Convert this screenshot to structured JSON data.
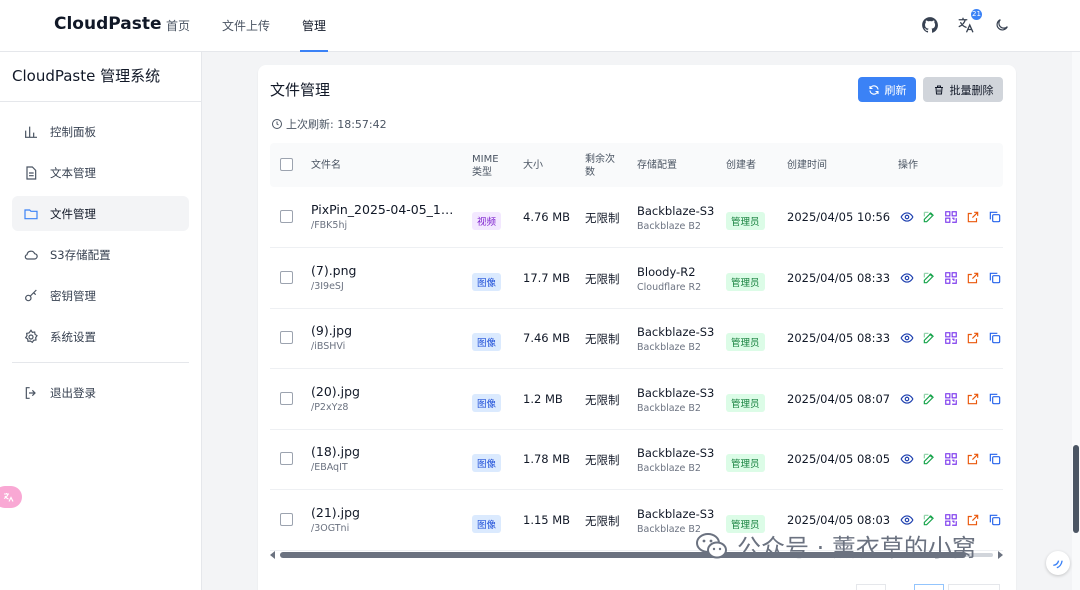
{
  "header": {
    "brand": "CloudPaste",
    "nav": [
      {
        "label": "首页",
        "active": false
      },
      {
        "label": "文件上传",
        "active": false
      },
      {
        "label": "管理",
        "active": true
      }
    ],
    "translate_badge": "21",
    "icons": [
      "github-icon",
      "translate-icon",
      "moon-icon"
    ]
  },
  "sidebar": {
    "title": "CloudPaste 管理系统",
    "items": [
      {
        "label": "控制面板",
        "icon": "chart-icon",
        "active": false
      },
      {
        "label": "文本管理",
        "icon": "document-icon",
        "active": false
      },
      {
        "label": "文件管理",
        "icon": "folder-icon",
        "active": true
      },
      {
        "label": "S3存储配置",
        "icon": "cloud-icon",
        "active": false
      },
      {
        "label": "密钥管理",
        "icon": "key-icon",
        "active": false
      },
      {
        "label": "系统设置",
        "icon": "gear-icon",
        "active": false
      }
    ],
    "logout": {
      "label": "退出登录",
      "icon": "logout-icon"
    }
  },
  "main": {
    "title": "文件管理",
    "refresh_label": "刷新",
    "batch_delete_label": "批量删除",
    "last_refresh": "上次刷新: 18:57:42",
    "columns": {
      "filename": "文件名",
      "mime_line1": "MIME",
      "mime_line2": "类型",
      "size": "大小",
      "remaining_line1": "剩余次",
      "remaining_line2": "数",
      "storage": "存储配置",
      "creator": "创建者",
      "created_at": "创建时间",
      "actions": "操作"
    },
    "rows": [
      {
        "name": "PixPin_2025-04-05_18...",
        "path": "/FBK5hj",
        "mime": "视频",
        "mime_kind": "video",
        "size": "4.76 MB",
        "remaining": "无限制",
        "storage": "Backblaze-S3",
        "storage_sub": "Backblaze B2",
        "creator": "管理员",
        "created": "2025/04/05 10:56"
      },
      {
        "name": "(7).png",
        "path": "/3I9eSJ",
        "mime": "图像",
        "mime_kind": "image",
        "size": "17.7 MB",
        "remaining": "无限制",
        "storage": "Bloody-R2",
        "storage_sub": "Cloudflare R2",
        "creator": "管理员",
        "created": "2025/04/05 08:33"
      },
      {
        "name": "(9).jpg",
        "path": "/iBSHVi",
        "mime": "图像",
        "mime_kind": "image",
        "size": "7.46 MB",
        "remaining": "无限制",
        "storage": "Backblaze-S3",
        "storage_sub": "Backblaze B2",
        "creator": "管理员",
        "created": "2025/04/05 08:33"
      },
      {
        "name": "(20).jpg",
        "path": "/P2xYz8",
        "mime": "图像",
        "mime_kind": "image",
        "size": "1.2 MB",
        "remaining": "无限制",
        "storage": "Backblaze-S3",
        "storage_sub": "Backblaze B2",
        "creator": "管理员",
        "created": "2025/04/05 08:07"
      },
      {
        "name": "(18).jpg",
        "path": "/EBAqIT",
        "mime": "图像",
        "mime_kind": "image",
        "size": "1.78 MB",
        "remaining": "无限制",
        "storage": "Backblaze-S3",
        "storage_sub": "Backblaze B2",
        "creator": "管理员",
        "created": "2025/04/05 08:05"
      },
      {
        "name": "(21).jpg",
        "path": "/3OGTni",
        "mime": "图像",
        "mime_kind": "image",
        "size": "1.15 MB",
        "remaining": "无限制",
        "storage": "Backblaze-S3",
        "storage_sub": "Backblaze B2",
        "creator": "管理员",
        "created": "2025/04/05 08:03"
      }
    ],
    "row_actions": [
      "eye-icon",
      "edit-icon",
      "qrcode-icon",
      "external-link-icon",
      "copy-icon"
    ]
  },
  "watermark": {
    "text": "公众号 · 薰衣草的小窝"
  },
  "colors": {
    "accent": "#3b82f6",
    "video_tag": "#7e22ce",
    "image_tag": "#1d4ed8",
    "creator_tag": "#15803d",
    "view": "#1e40af",
    "edit": "#16a34a",
    "qr": "#7c3aed",
    "link": "#ea580c",
    "copy": "#2563eb"
  }
}
